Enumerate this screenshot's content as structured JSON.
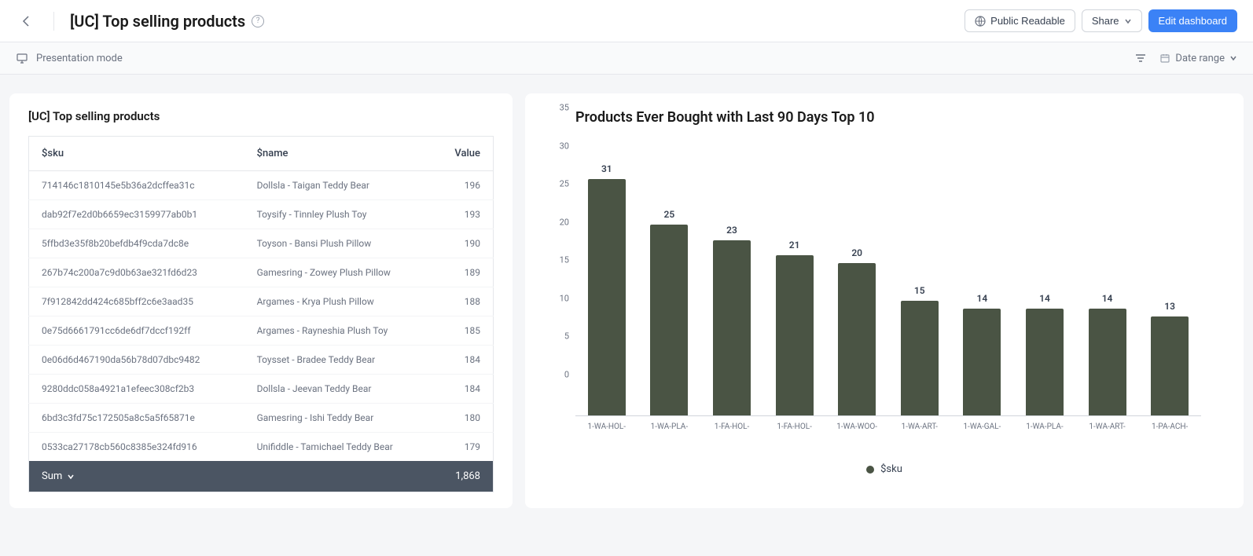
{
  "header": {
    "title": "[UC] Top selling products",
    "public_readable": "Public Readable",
    "share": "Share",
    "edit": "Edit dashboard"
  },
  "toolbar": {
    "presentation": "Presentation mode",
    "date_range": "Date range"
  },
  "table": {
    "title": "[UC] Top selling products",
    "columns": {
      "sku": "$sku",
      "name": "$name",
      "value": "Value"
    },
    "rows": [
      {
        "sku": "714146c1810145e5b36a2dcffea31c",
        "name": "Dollsla - Taigan Teddy Bear",
        "value": "196"
      },
      {
        "sku": "dab92f7e2d0b6659ec3159977ab0b1",
        "name": "Toysify - Tinnley Plush Toy",
        "value": "193"
      },
      {
        "sku": "5ffbd3e35f8b20befdb4f9cda7dc8e",
        "name": "Toyson - Bansi Plush Pillow",
        "value": "190"
      },
      {
        "sku": "267b74c200a7c9d0b63ae321fd6d23",
        "name": "Gamesring - Zowey Plush Pillow",
        "value": "189"
      },
      {
        "sku": "7f912842dd424c685bff2c6e3aad35",
        "name": "Argames - Krya Plush Pillow",
        "value": "188"
      },
      {
        "sku": "0e75d6661791cc6de6df7dccf192ff",
        "name": "Argames - Rayneshia Plush Toy",
        "value": "185"
      },
      {
        "sku": "0e06d6d467190da56b78d07dbc9482",
        "name": "Toysset - Bradee Teddy Bear",
        "value": "184"
      },
      {
        "sku": "9280ddc058a4921a1efeec308cf2b3",
        "name": "Dollsla - Jeevan Teddy Bear",
        "value": "184"
      },
      {
        "sku": "6bd3c3fd75c172505a8c5a5f65871e",
        "name": "Gamesring - Ishi Teddy Bear",
        "value": "180"
      },
      {
        "sku": "0533ca27178cb560c8385e324fd916",
        "name": "Unifiddle - Tamichael Teddy Bear",
        "value": "179"
      }
    ],
    "sum_label": "Sum",
    "sum_value": "1,868"
  },
  "chart": {
    "title": "Products Ever Bought with Last 90 Days Top 10",
    "legend": "$sku"
  },
  "chart_data": {
    "type": "bar",
    "categories": [
      "1-WA-HOL-",
      "1-WA-PLA-",
      "1-FA-HOL-",
      "1-FA-HOL-",
      "1-WA-WOO-",
      "1-WA-ART-",
      "1-WA-GAL-",
      "1-WA-PLA-",
      "1-WA-ART-",
      "1-PA-ACH-"
    ],
    "values": [
      31,
      25,
      23,
      21,
      20,
      15,
      14,
      14,
      14,
      13
    ],
    "ylim": [
      0,
      35
    ],
    "yticks": [
      0,
      5,
      10,
      15,
      20,
      25,
      30,
      35
    ],
    "ylabel": "",
    "xlabel": "",
    "title": "Products Ever Bought with Last 90 Days Top 10",
    "bar_color": "#4a5444"
  }
}
